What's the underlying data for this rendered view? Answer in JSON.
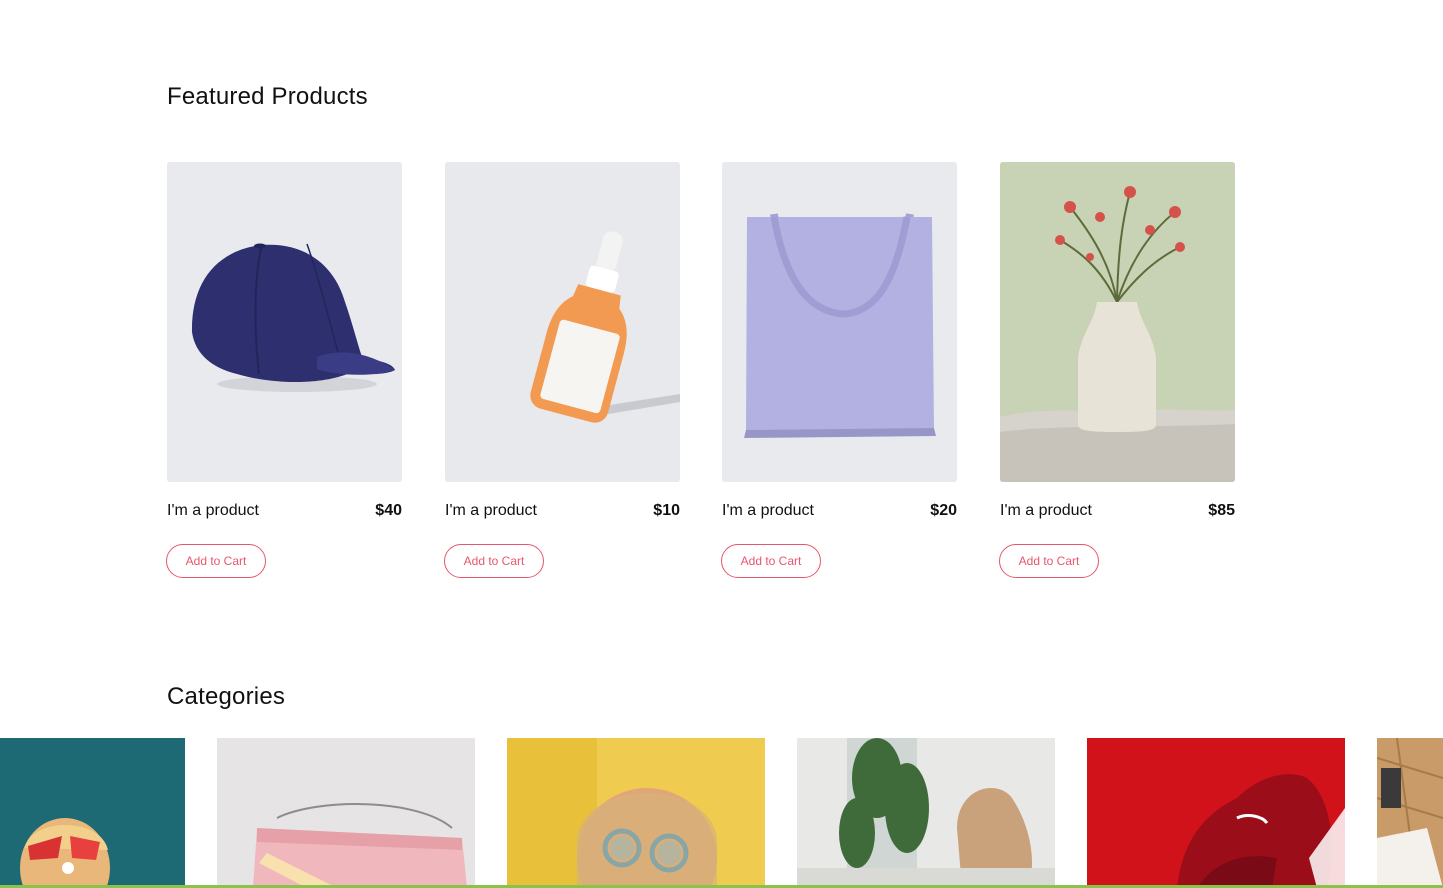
{
  "featured": {
    "title": "Featured Products",
    "products": [
      {
        "name": "I'm a product",
        "price": "$40",
        "image": "navy-baseball-cap",
        "cta": "Add to Cart"
      },
      {
        "name": "I'm a product",
        "price": "$10",
        "image": "orange-dropper-bottle",
        "cta": "Add to Cart"
      },
      {
        "name": "I'm a product",
        "price": "$20",
        "image": "lavender-tote-bag",
        "cta": "Add to Cart"
      },
      {
        "name": "I'm a product",
        "price": "$85",
        "image": "vase-with-roses",
        "cta": "Add to Cart"
      }
    ]
  },
  "categories": {
    "title": "Categories",
    "tiles": [
      {
        "image": "woman-with-heart-sunglasses-teal"
      },
      {
        "image": "pink-handbag"
      },
      {
        "image": "woman-round-sunglasses-yellow"
      },
      {
        "image": "woman-on-sofa-with-plants"
      },
      {
        "image": "red-sneaker"
      },
      {
        "image": "wooden-floor-partial"
      }
    ]
  },
  "colors": {
    "accent": "#e8566c",
    "card_bg": "#e8e9ed",
    "bottom_bar": "#8bc34a"
  }
}
